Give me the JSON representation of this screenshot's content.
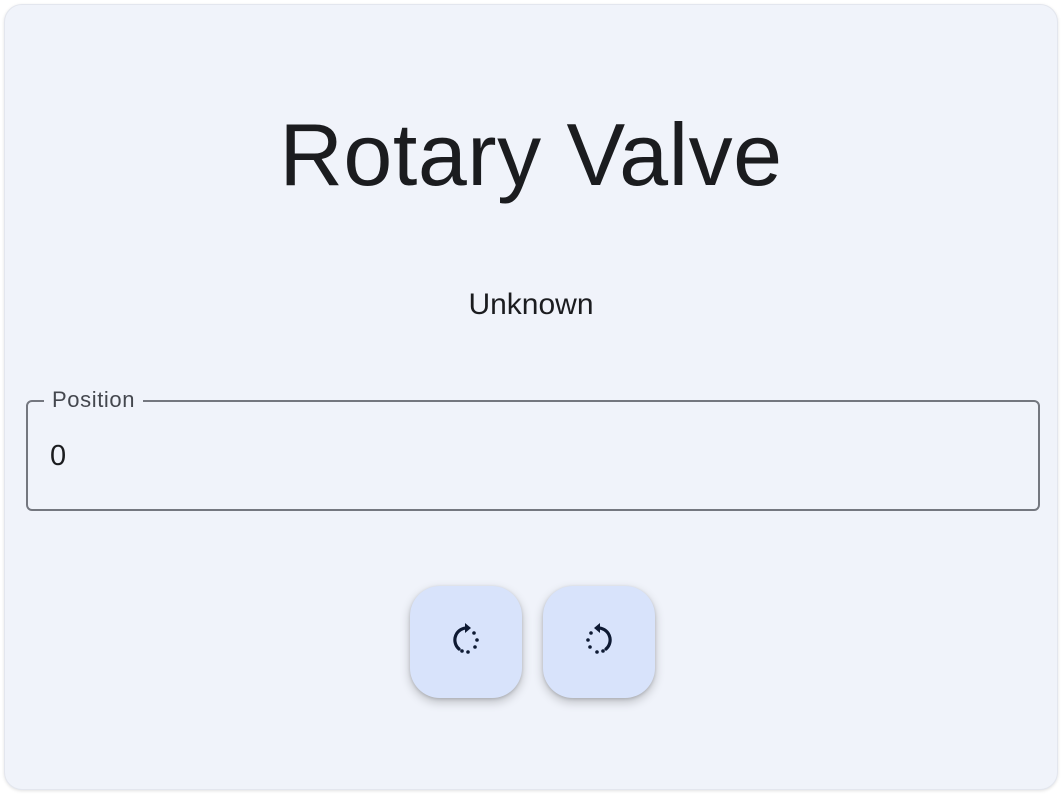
{
  "valve": {
    "title": "Rotary Valve",
    "status": "Unknown",
    "position_field": {
      "label": "Position",
      "value": "0"
    },
    "buttons": [
      {
        "name": "rotate-clockwise",
        "icon": "rotate-clockwise-icon"
      },
      {
        "name": "rotate-counterclockwise",
        "icon": "rotate-counterclockwise-icon"
      }
    ]
  },
  "colors": {
    "card_background": "#f0f3fa",
    "button_background": "#d8e3fb",
    "text": "#1b1c1f",
    "outline": "#74777f"
  }
}
